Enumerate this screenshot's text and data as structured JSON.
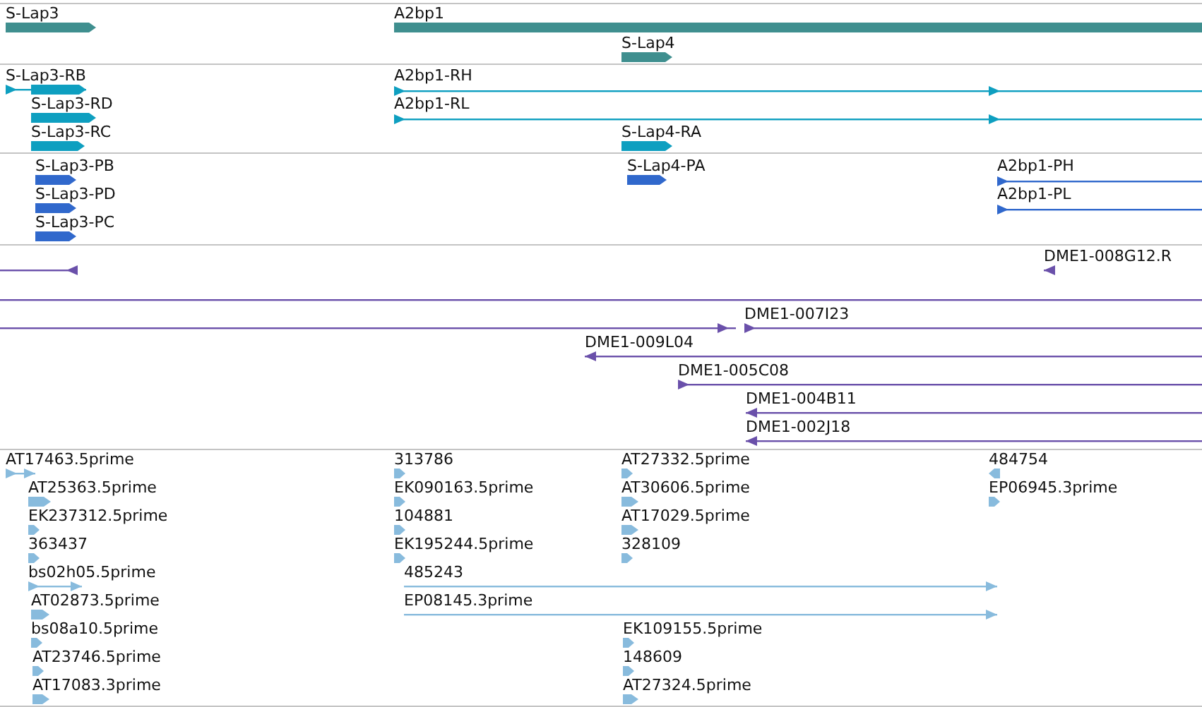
{
  "tracks": [
    {
      "color": "#3f8f8f",
      "features": [
        {
          "label": "S-Lap3",
          "kind": "bar",
          "reverse": false
        },
        {
          "label": "A2bp1",
          "kind": "bar"
        },
        {
          "label": "S-Lap4",
          "kind": "bar",
          "reverse": false
        }
      ]
    },
    {
      "color": "#0e9fc0",
      "features": [
        {
          "label": "S-Lap3-RB",
          "kind": "line",
          "reverse": false
        },
        {
          "label": "S-Lap3-RD",
          "kind": "bar",
          "reverse": false
        },
        {
          "label": "S-Lap3-RC",
          "kind": "bar",
          "reverse": false
        },
        {
          "label": "A2bp1-RH",
          "kind": "line",
          "reverse": false
        },
        {
          "label": "A2bp1-RL",
          "kind": "line",
          "reverse": false
        },
        {
          "label": "S-Lap4-RA",
          "kind": "bar",
          "reverse": false
        }
      ]
    },
    {
      "color": "#3068cc",
      "features": [
        {
          "label": "S-Lap3-PB",
          "kind": "bar",
          "reverse": false
        },
        {
          "label": "S-Lap3-PD",
          "kind": "bar",
          "reverse": false
        },
        {
          "label": "S-Lap3-PC",
          "kind": "bar",
          "reverse": false
        },
        {
          "label": "S-Lap4-PA",
          "kind": "bar",
          "reverse": false
        },
        {
          "label": "A2bp1-PH",
          "kind": "line",
          "reverse": false
        },
        {
          "label": "A2bp1-PL",
          "kind": "line",
          "reverse": false
        }
      ]
    },
    {
      "color": "#6a50aa",
      "features": [
        {
          "kind": "line",
          "reverse": true
        },
        {
          "label": "DME1-008G12.R",
          "kind": "line",
          "reverse": true
        },
        {
          "kind": "line"
        },
        {
          "kind": "line",
          "reverse": false
        },
        {
          "label": "DME1-007I23",
          "kind": "line",
          "reverse": false
        },
        {
          "label": "DME1-009L04",
          "kind": "line",
          "reverse": true
        },
        {
          "label": "DME1-005C08",
          "kind": "line",
          "reverse": false
        },
        {
          "label": "DME1-004B11",
          "kind": "line",
          "reverse": true
        },
        {
          "label": "DME1-002J18",
          "kind": "line",
          "reverse": true
        }
      ]
    },
    {
      "color": "#88bbdd",
      "features": [
        {
          "label": "AT17463.5prime",
          "kind": "line",
          "reverse": false
        },
        {
          "label": "AT25363.5prime",
          "kind": "bar",
          "reverse": false
        },
        {
          "label": "EK237312.5prime",
          "kind": "bar",
          "reverse": false
        },
        {
          "label": "363437",
          "kind": "bar",
          "reverse": false
        },
        {
          "label": "bs02h05.5prime",
          "kind": "line",
          "reverse": false
        },
        {
          "label": "AT02873.5prime",
          "kind": "bar",
          "reverse": false
        },
        {
          "label": "bs08a10.5prime",
          "kind": "bar",
          "reverse": false
        },
        {
          "label": "AT23746.5prime",
          "kind": "bar",
          "reverse": false
        },
        {
          "label": "AT17083.3prime",
          "kind": "bar",
          "reverse": false
        },
        {
          "label": "313786",
          "kind": "bar",
          "reverse": false
        },
        {
          "label": "EK090163.5prime",
          "kind": "bar",
          "reverse": false
        },
        {
          "label": "104881",
          "kind": "bar",
          "reverse": false
        },
        {
          "label": "EK195244.5prime",
          "kind": "bar",
          "reverse": false
        },
        {
          "label": "485243",
          "kind": "line",
          "reverse": false
        },
        {
          "label": "EP08145.3prime",
          "kind": "line",
          "reverse": false
        },
        {
          "label": "AT27332.5prime",
          "kind": "bar",
          "reverse": false
        },
        {
          "label": "AT30606.5prime",
          "kind": "bar",
          "reverse": false
        },
        {
          "label": "AT17029.5prime",
          "kind": "bar",
          "reverse": false
        },
        {
          "label": "328109",
          "kind": "bar",
          "reverse": false
        },
        {
          "label": "EK109155.5prime",
          "kind": "bar",
          "reverse": false
        },
        {
          "label": "148609",
          "kind": "bar",
          "reverse": false
        },
        {
          "label": "AT27324.5prime",
          "kind": "bar",
          "reverse": false
        },
        {
          "label": "484754",
          "kind": "bar",
          "reverse": true
        },
        {
          "label": "EP06945.3prime",
          "kind": "bar",
          "reverse": false
        }
      ]
    }
  ]
}
